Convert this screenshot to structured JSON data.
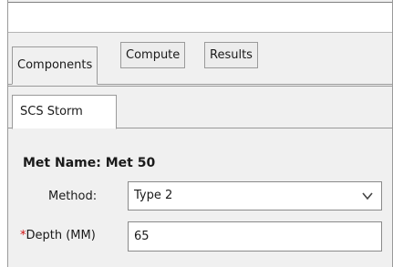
{
  "outer_tabs": [
    {
      "label": "Components",
      "active": true
    },
    {
      "label": "Compute",
      "active": false
    },
    {
      "label": "Results",
      "active": false
    }
  ],
  "inner_tabs": [
    {
      "label": "SCS Storm",
      "active": true
    }
  ],
  "met": {
    "name_label": "Met Name: Met 50"
  },
  "method": {
    "label": "Method:",
    "value": "Type 2",
    "icon": "chevron-down-icon"
  },
  "depth": {
    "required_marker": "*",
    "label": "Depth (MM)",
    "value": "65"
  },
  "colors": {
    "required": "#d01010",
    "panel_bg": "#f0f0f0"
  }
}
